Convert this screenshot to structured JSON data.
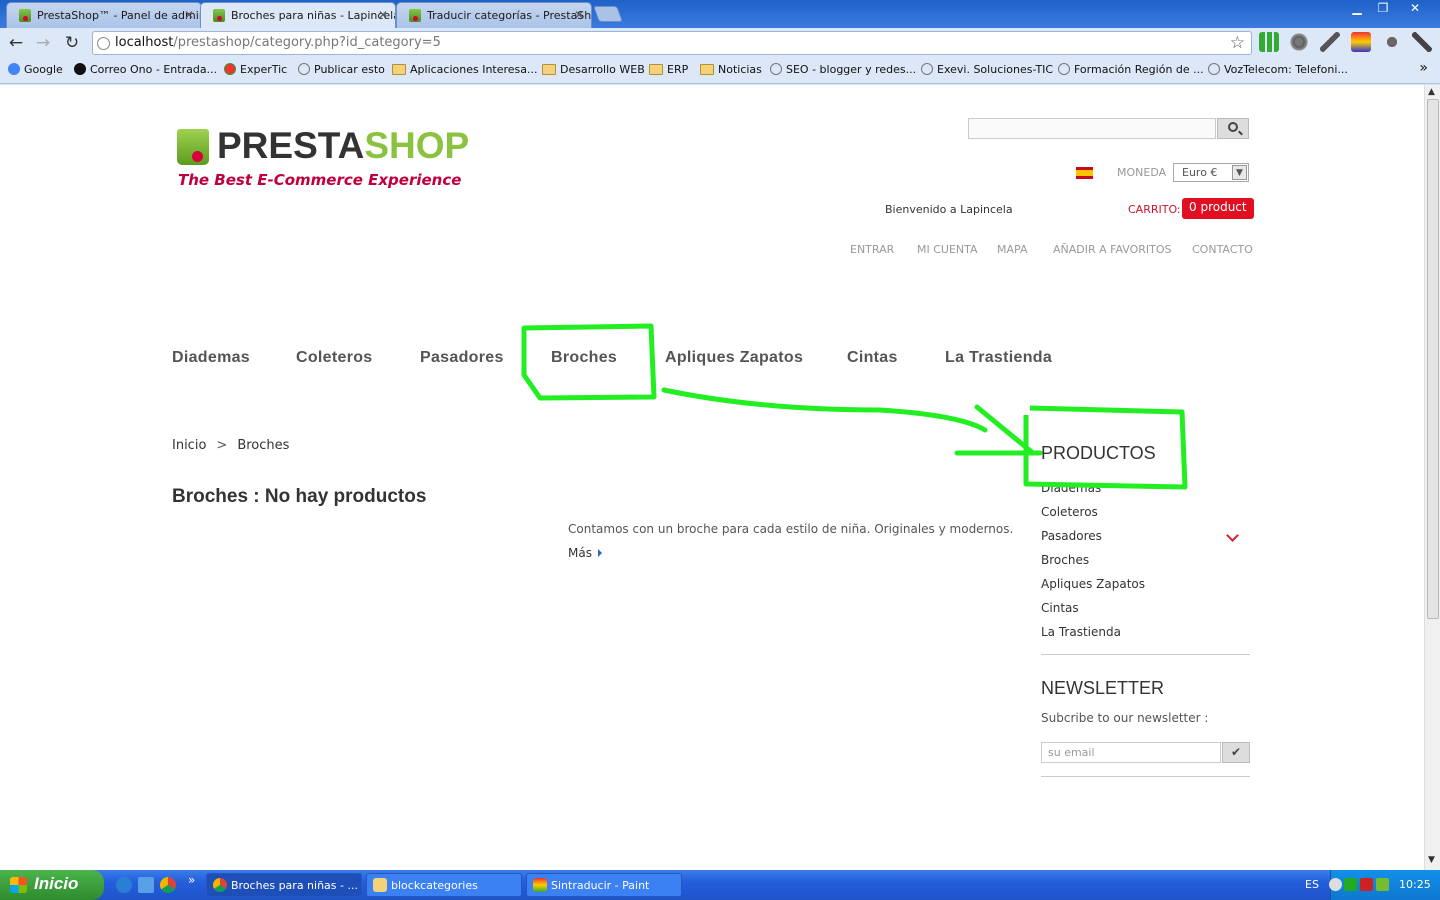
{
  "browser": {
    "tabs": [
      {
        "title": "PrestaShop™ - Panel de admir",
        "active": false
      },
      {
        "title": "Broches para niñas - Lapincela",
        "active": true
      },
      {
        "title": "Traducir categorías - PrestaSh",
        "active": false
      }
    ],
    "url_host": "localhost",
    "url_path": "/prestashop/category.php?id_category=5",
    "bookmarks": [
      "Google",
      "Correo Ono - Entrada...",
      "ExperTic",
      "Publicar esto",
      "Aplicaciones Interesa...",
      "Desarrollo WEB",
      "ERP",
      "Noticias",
      "SEO - blogger y redes...",
      "Exevi. Soluciones-TIC",
      "Formación Región de ...",
      "VozTelecom: Telefoni..."
    ],
    "bookmarks_more": "»"
  },
  "header": {
    "logo_text_1": "PRESTA",
    "logo_text_2": "SHOP",
    "logo_tagline": "The Best E-Commerce Experience",
    "moneda_label": "MONEDA",
    "currency_value": "Euro €",
    "welcome": "Bienvenido a Lapincela",
    "cart_label": "CARRITO:",
    "cart_button": "0 product",
    "links": [
      "ENTRAR",
      "MI CUENTA",
      "MAPA",
      "AÑADIR A FAVORITOS",
      "CONTACTO"
    ]
  },
  "menu": [
    "Diademas",
    "Coleteros",
    "Pasadores",
    "Broches",
    "Apliques Zapatos",
    "Cintas",
    "La Trastienda"
  ],
  "breadcrumb": {
    "home": "Inicio",
    "sep": ">",
    "current": "Broches"
  },
  "main": {
    "title": "Broches : No hay productos",
    "description": "Contamos con un broche para cada estilo de niña. Originales y modernos.",
    "more": "Más"
  },
  "sidebar": {
    "productos_title": "PRODUCTOS",
    "categories": [
      "Diademas",
      "Coleteros",
      "Pasadores",
      "Broches",
      "Apliques Zapatos",
      "Cintas",
      "La Trastienda"
    ],
    "newsletter_title": "NEWSLETTER",
    "newsletter_text": "Subcribe to our newsletter :",
    "newsletter_placeholder": "su email"
  },
  "annotation_color": "#22ee22",
  "taskbar": {
    "start": "Inicio",
    "windows": [
      "Broches para niñas - ...",
      "blockcategories",
      "Sintraducir - Paint"
    ],
    "quicklaunch_more": "»",
    "lang": "ES",
    "clock": "10:25"
  }
}
